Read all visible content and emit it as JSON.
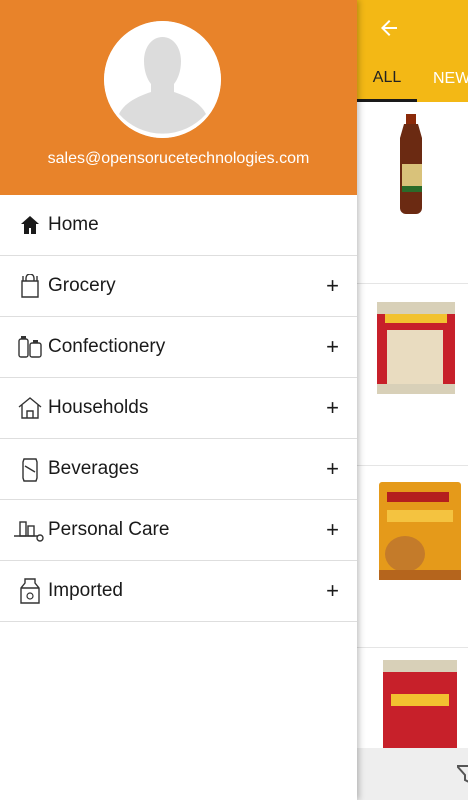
{
  "drawer": {
    "email": "sales@opensorucetechnologies.com",
    "menu": [
      {
        "label": "Home",
        "expand": ""
      },
      {
        "label": "Grocery",
        "expand": "+"
      },
      {
        "label": "Confectionery",
        "expand": "+"
      },
      {
        "label": "Households",
        "expand": "+"
      },
      {
        "label": "Beverages",
        "expand": "+"
      },
      {
        "label": "Personal Care",
        "expand": "+"
      },
      {
        "label": "Imported",
        "expand": "+"
      }
    ]
  },
  "app": {
    "tabs": [
      "ALL",
      "NEW"
    ]
  },
  "colors": {
    "drawer_header": "#e8832a",
    "toolbar": "#f3b815"
  }
}
